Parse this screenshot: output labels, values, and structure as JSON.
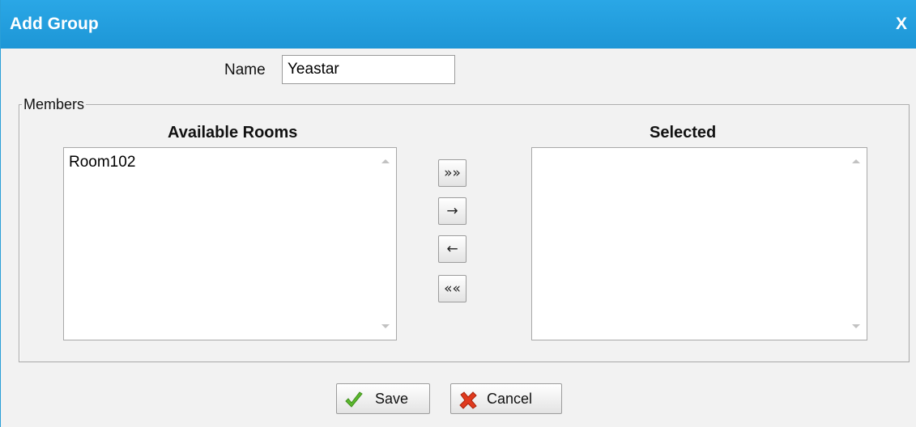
{
  "dialog": {
    "title": "Add Group",
    "close_label": "X"
  },
  "name_field": {
    "label": "Name",
    "value": "Yeastar"
  },
  "members": {
    "legend": "Members",
    "available": {
      "heading": "Available Rooms",
      "items": [
        "Room102"
      ]
    },
    "selected": {
      "heading": "Selected",
      "items": []
    },
    "move_buttons": {
      "add_all": "»»",
      "add": "→",
      "remove": "←",
      "remove_all": "««"
    }
  },
  "footer": {
    "save_label": "Save",
    "cancel_label": "Cancel"
  },
  "colors": {
    "titlebar": "#1d96d6",
    "save_icon": "#5cb82e",
    "cancel_icon": "#e03a1e"
  },
  "icons": {
    "save": "checkmark-icon",
    "cancel": "x-mark-icon"
  }
}
